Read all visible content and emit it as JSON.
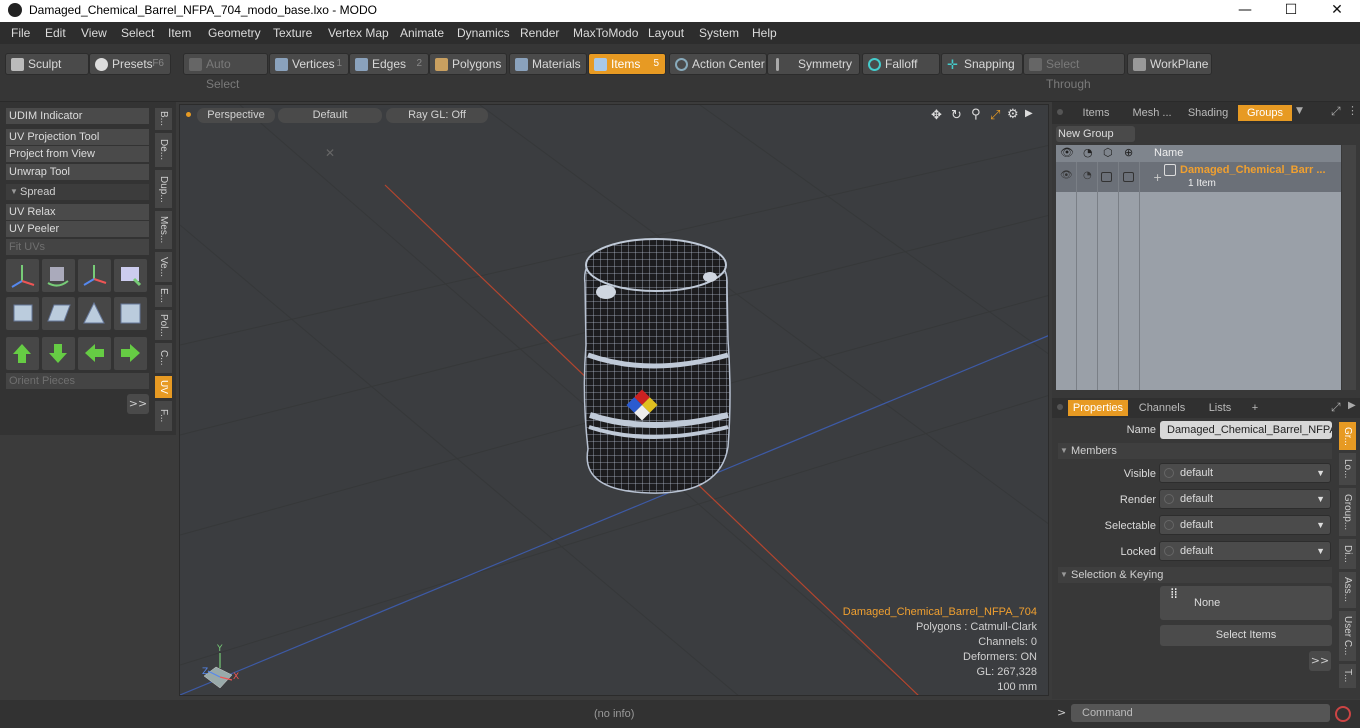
{
  "window": {
    "title": "Damaged_Chemical_Barrel_NFPA_704_modo_base.lxo - MODO",
    "min": "—",
    "max": "☐",
    "close": "✕"
  },
  "menu": [
    "File",
    "Edit",
    "View",
    "Select",
    "Item",
    "Geometry",
    "Texture",
    "Vertex Map",
    "Animate",
    "Dynamics",
    "Render",
    "MaxToModo",
    "Layout",
    "System",
    "Help"
  ],
  "toolbar": {
    "sculpt": "Sculpt",
    "presets": "Presets",
    "presets_key": "F6",
    "auto_select": "Auto Select",
    "vertices": "Vertices",
    "vertices_key": "1",
    "edges": "Edges",
    "edges_key": "2",
    "polygons": "Polygons",
    "materials": "Materials",
    "items": "Items",
    "items_key": "5",
    "action_center": "Action Center",
    "symmetry": "Symmetry",
    "falloff": "Falloff",
    "snapping": "Snapping",
    "select_through": "Select Through",
    "workplane": "WorkPlane"
  },
  "left": {
    "buttons": [
      "UDIM Indicator",
      "UV Projection Tool",
      "Project from View",
      "Unwrap Tool"
    ],
    "spread": "Spread",
    "buttons2": [
      "UV Relax",
      "UV Peeler"
    ],
    "fit_uvs": "Fit UVs",
    "orient_pieces": "Orient Pieces",
    "more": ">>",
    "vtabs": [
      "B...",
      "De...",
      "Dup...",
      "Mes...",
      "Ve...",
      "E...",
      "Pol...",
      "C...",
      "UV",
      "F..."
    ]
  },
  "viewport": {
    "view": "Perspective",
    "shading": "Default",
    "raygl": "Ray GL: Off",
    "info": {
      "name": "Damaged_Chemical_Barrel_NFPA_704",
      "polygons": "Polygons : Catmull-Clark",
      "channels": "Channels: 0",
      "deformers": "Deformers: ON",
      "gl": "GL: 267,328",
      "scale": "100 mm"
    },
    "axis": {
      "y": "Y",
      "x": "X",
      "z": "Z"
    }
  },
  "right": {
    "tabs": [
      "Items",
      "Mesh ...",
      "Shading",
      "Groups"
    ],
    "new_group": "New Group",
    "col_name": "Name",
    "group_name": "Damaged_Chemical_Barr ...",
    "group_count": "1 Item",
    "ptabs": [
      "Properties",
      "Channels",
      "Lists",
      "+"
    ],
    "props": {
      "name_label": "Name",
      "name_value": "Damaged_Chemical_Barrel_NFPA",
      "members": "Members",
      "visible_label": "Visible",
      "render_label": "Render",
      "selectable_label": "Selectable",
      "locked_label": "Locked",
      "default": "default",
      "sel_keying": "Selection & Keying",
      "none": "None",
      "select_items": "Select Items",
      "more": ">>"
    },
    "svtabs": [
      "Gr...",
      "Lo...",
      "Group...",
      "Di...",
      "Ass...",
      "User C...",
      "T..."
    ]
  },
  "status": {
    "info": "(no info)",
    "command": "Command"
  },
  "colors": {
    "accent": "#e79a23",
    "info_orange": "#f0a030"
  }
}
